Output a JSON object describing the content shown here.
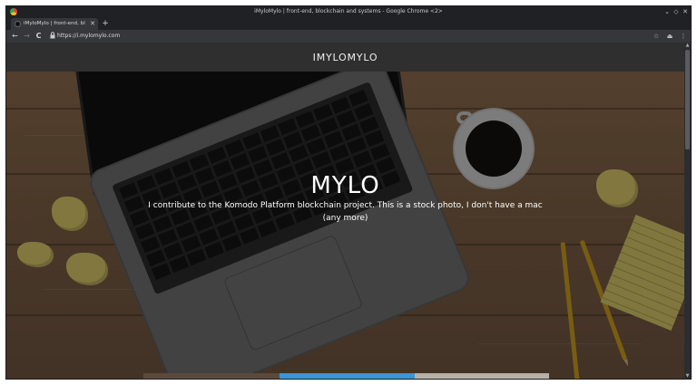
{
  "window": {
    "title": "iMyloMylo | front-end, blockchain and systems - Google Chrome <2>",
    "controls": {
      "minimize": "⌄",
      "maximize": "◇",
      "close": "✕"
    }
  },
  "tab": {
    "label": "iMyloMylo | front-end, bloc",
    "close": "✕"
  },
  "toolbar": {
    "back": "←",
    "forward": "→",
    "reload": "C",
    "url": "https://i.mylomylo.com",
    "bookmark": "☆",
    "extension": "⏏",
    "menu": "⋮"
  },
  "site": {
    "brand": "IMYLOMYLO",
    "hero": {
      "title": "MYLO",
      "text": "I contribute to the Komodo Platform blockchain project.  This is a stock photo, I don't have a mac (any more)"
    }
  },
  "colors": {
    "chrome_dark": "#1f2124",
    "toolbar": "#35373b",
    "header": "#2f2f2f",
    "thumb_1": "#5b4a3c",
    "thumb_2": "#3b95d6",
    "thumb_3": "#b7b0a6"
  },
  "icons": {
    "new_tab": "+",
    "lock": "🔒",
    "scroll_up": "▲",
    "scroll_down": "▼"
  }
}
